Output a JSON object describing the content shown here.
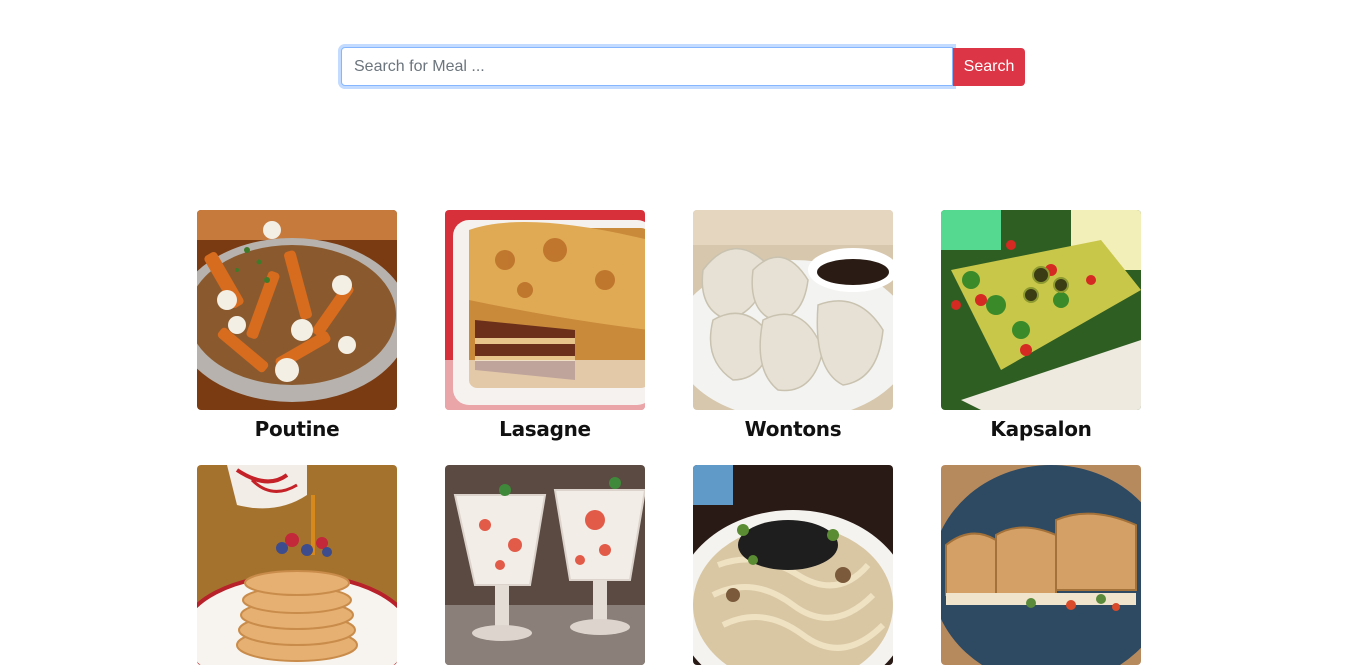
{
  "search": {
    "placeholder": "Search for Meal ...",
    "value": "",
    "button_label": "Search"
  },
  "meals": [
    {
      "name": "Poutine"
    },
    {
      "name": "Lasagne"
    },
    {
      "name": "Wontons"
    },
    {
      "name": "Kapsalon"
    },
    {
      "name": ""
    },
    {
      "name": ""
    },
    {
      "name": ""
    },
    {
      "name": ""
    }
  ],
  "colors": {
    "search_button": "#dc3545",
    "focus_ring": "#86b7fe"
  }
}
